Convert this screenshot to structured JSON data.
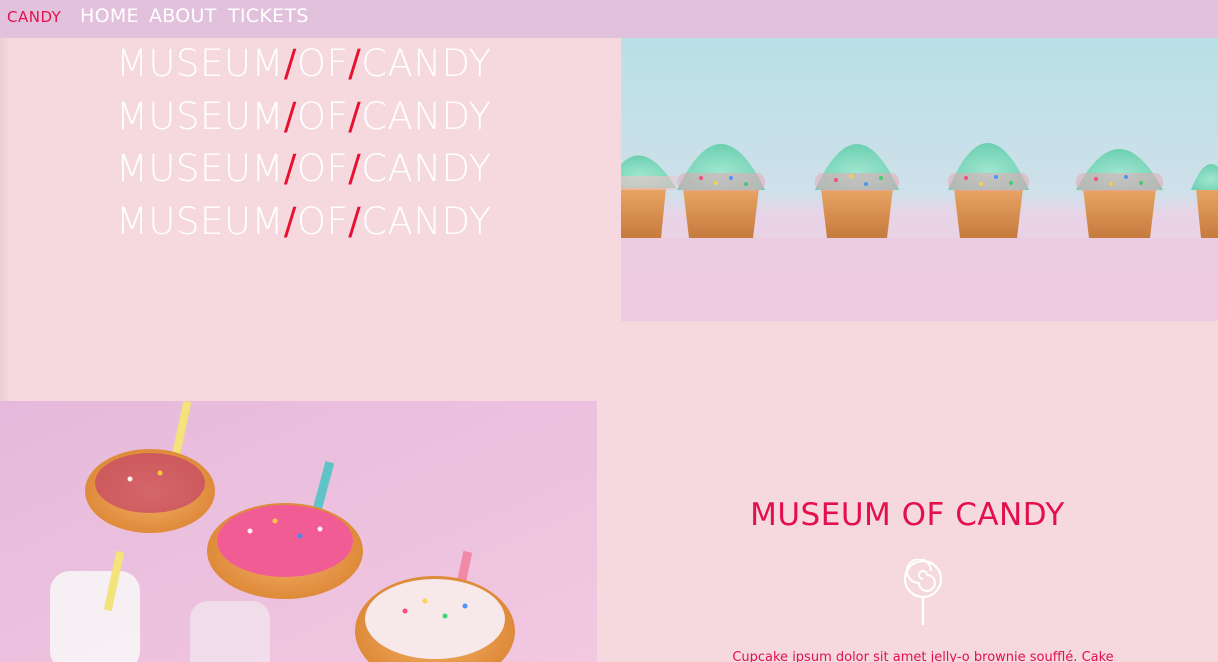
{
  "nav": {
    "brand": "CANDY",
    "links": [
      "HOME",
      "ABOUT",
      "TICKETS"
    ]
  },
  "hero": {
    "title_lines": [
      {
        "word1": "MUSEUM",
        "word2": "OF",
        "word3": "CANDY"
      },
      {
        "word1": "MUSEUM",
        "word2": "OF",
        "word3": "CANDY"
      },
      {
        "word1": "MUSEUM",
        "word2": "OF",
        "word3": "CANDY"
      },
      {
        "word1": "MUSEUM",
        "word2": "OF",
        "word3": "CANDY"
      }
    ],
    "separator": "/",
    "cupcakes_image_alt": "cupcakes-with-sprinkles-photo"
  },
  "info": {
    "title": "MUSEUM OF CANDY",
    "icon": "lollipop-icon",
    "text": "Cupcake ipsum dolor sit amet jelly-o brownie soufflé. Cake",
    "donuts_image_alt": "donuts-with-straws-photo"
  },
  "colors": {
    "accent": "#e3104c",
    "nav_bg": "#e2c1dd",
    "page_bg": "#f5d9df",
    "slash": "#e8102f",
    "white": "#ffffff"
  }
}
